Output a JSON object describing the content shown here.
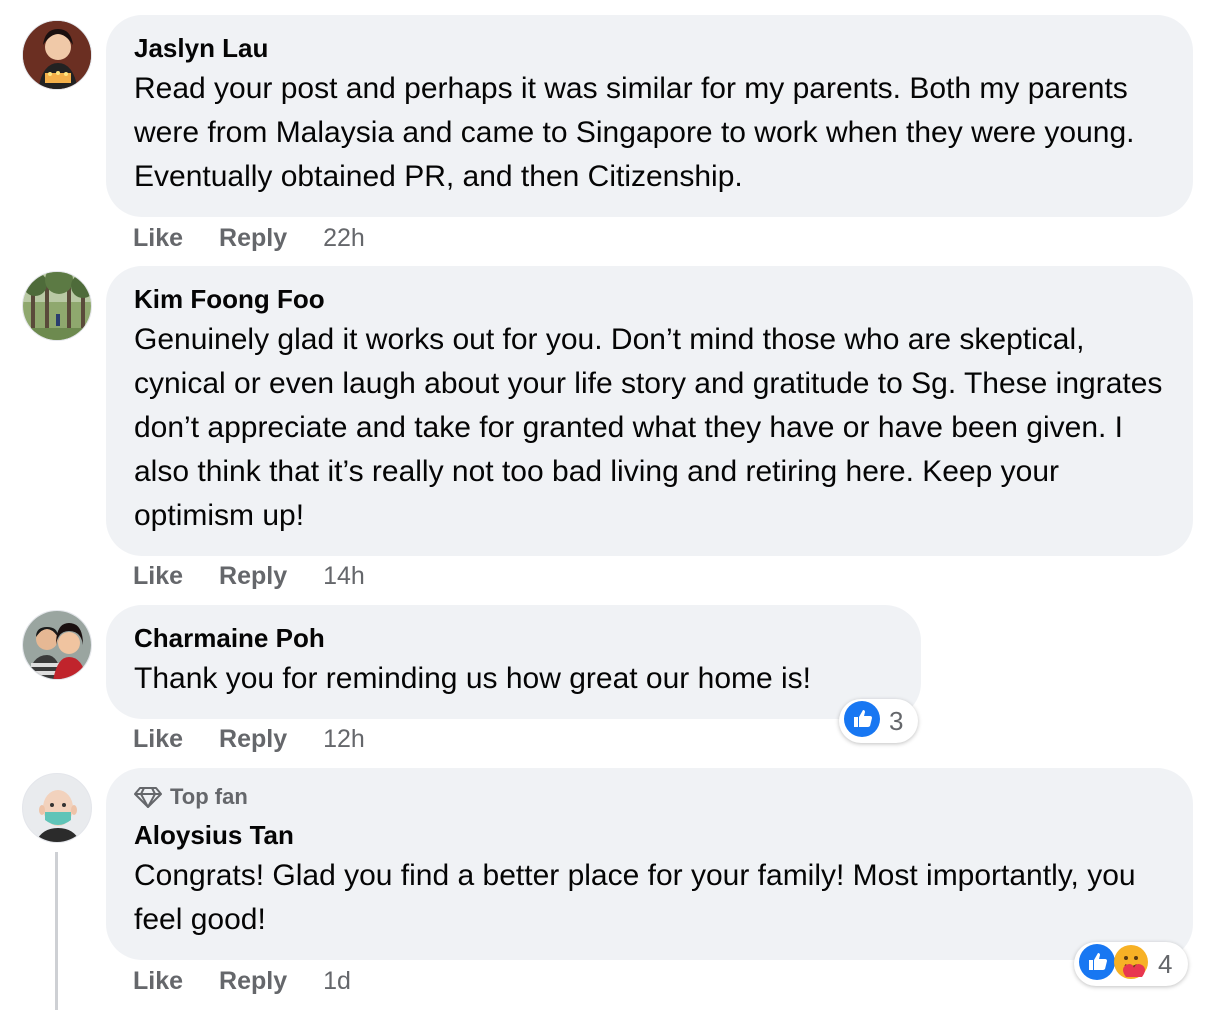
{
  "comments": [
    {
      "author": "Jaslyn Lau",
      "text": "Read your post and perhaps it was similar for my parents. Both my parents were from Malaysia and came to Singapore to work when they were young. Eventually obtained PR, and then Citizenship.",
      "like": "Like",
      "reply": "Reply",
      "time": "22h"
    },
    {
      "author": "Kim Foong Foo",
      "text": "Genuinely glad it works out for you. Don’t mind those who are skeptical, cynical or even laugh about your life story and gratitude to Sg. These ingrates don’t appreciate and take for granted what they have or have been given. I also think that it’s really not too bad living and retiring here. Keep your optimism up!",
      "like": "Like",
      "reply": "Reply",
      "time": "14h"
    },
    {
      "author": "Charmaine Poh",
      "text": "Thank you for reminding us how great our home is!",
      "like": "Like",
      "reply": "Reply",
      "time": "12h",
      "reaction_count": "3",
      "reaction_icons": [
        "like-reaction-icon"
      ]
    },
    {
      "badge": "Top fan",
      "badge_icon": "diamond-icon",
      "author": "Aloysius Tan",
      "text": "Congrats! Glad you find a better place for your family! Most importantly, you feel good!",
      "like": "Like",
      "reply": "Reply",
      "time": "1d",
      "reaction_count": "4",
      "reaction_icons": [
        "like-reaction-icon",
        "care-reaction-icon"
      ]
    }
  ],
  "colors": {
    "bubble": "#f0f2f5",
    "meta_text": "#65676b",
    "like_blue": "#1877f2",
    "care_yellow": "#f7b125"
  }
}
